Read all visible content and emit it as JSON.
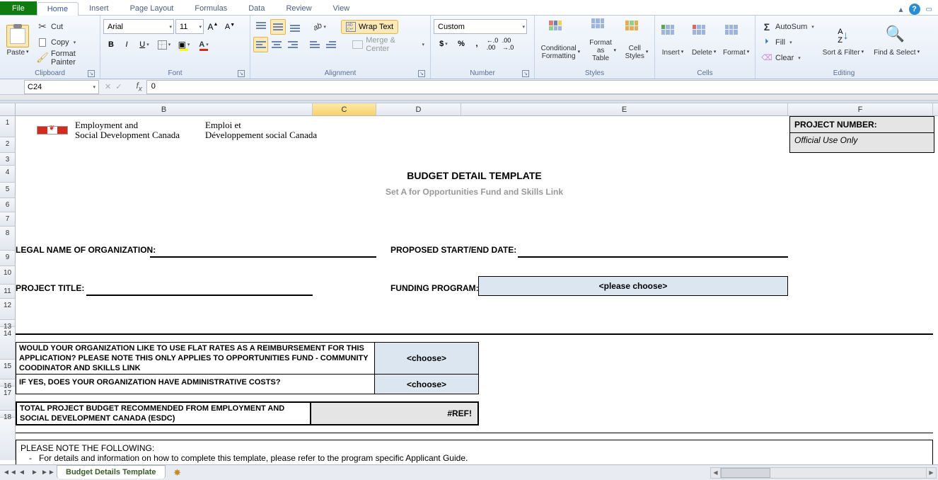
{
  "tabs": {
    "file": "File",
    "home": "Home",
    "insert": "Insert",
    "page_layout": "Page Layout",
    "formulas": "Formulas",
    "data": "Data",
    "review": "Review",
    "view": "View"
  },
  "ribbon": {
    "clipboard": {
      "label": "Clipboard",
      "paste": "Paste",
      "cut": "Cut",
      "copy": "Copy",
      "format_painter": "Format Painter"
    },
    "font_group": {
      "label": "Font",
      "font": "Arial",
      "size": "11"
    },
    "alignment": {
      "label": "Alignment",
      "wrap": "Wrap Text",
      "merge": "Merge & Center"
    },
    "number": {
      "label": "Number",
      "format": "Custom"
    },
    "styles": {
      "label": "Styles",
      "conditional": "Conditional Formatting",
      "as_table": "Format as Table",
      "cell_styles": "Cell Styles"
    },
    "cells": {
      "label": "Cells",
      "insert": "Insert",
      "delete": "Delete",
      "format": "Format"
    },
    "editing": {
      "label": "Editing",
      "autosum": "AutoSum",
      "fill": "Fill",
      "clear": "Clear",
      "sort": "Sort & Filter",
      "find": "Find & Select"
    }
  },
  "name_box": "C24",
  "formula_value": "0",
  "columns": {
    "B": "B",
    "C": "C",
    "D": "D",
    "E": "E",
    "F": "F"
  },
  "row_numbers": [
    "1",
    "2",
    "3",
    "4",
    "5",
    "6",
    "7",
    "8",
    "9",
    "10",
    "11",
    "12",
    "13",
    "14",
    "15",
    "16",
    "17",
    "18"
  ],
  "doc": {
    "dept_en_1": "Employment and",
    "dept_en_2": "Social Development Canada",
    "dept_fr_1": "Emploi et",
    "dept_fr_2": "Développement social Canada",
    "title": "BUDGET DETAIL TEMPLATE",
    "subtitle": "Set A for Opportunities Fund and Skills Link",
    "proj_num_label": "PROJECT NUMBER:",
    "official": "Official Use Only",
    "legal_name": "LEGAL NAME OF ORGANIZATION:",
    "proposed": "PROPOSED START/END DATE:",
    "proj_title": "PROJECT TITLE:",
    "funding": "FUNDING PROGRAM:",
    "please_choose": "<please choose>",
    "q_flat": "WOULD YOUR ORGANIZATION LIKE TO USE FLAT RATES AS A REIMBURSEMENT FOR THIS APPLICATION?  PLEASE NOTE THIS ONLY APPLIES TO OPPORTUNITIES FUND - COMMUNITY COODINATOR AND SKILLS LINK",
    "q_admin": "IF YES, DOES YOUR ORGANIZATION HAVE ADMINISTRATIVE COSTS?",
    "choose": "<choose>",
    "total_label": "TOTAL PROJECT BUDGET RECOMMENDED FROM EMPLOYMENT AND SOCIAL DEVELOPMENT CANADA (ESDC)",
    "ref_err": "#REF!",
    "note_hdr": "PLEASE NOTE THE FOLLOWING:",
    "note_1": "For details and information on how to complete this template, please refer to the program specific Applicant Guide."
  },
  "sheet_tab": "Budget Details Template"
}
